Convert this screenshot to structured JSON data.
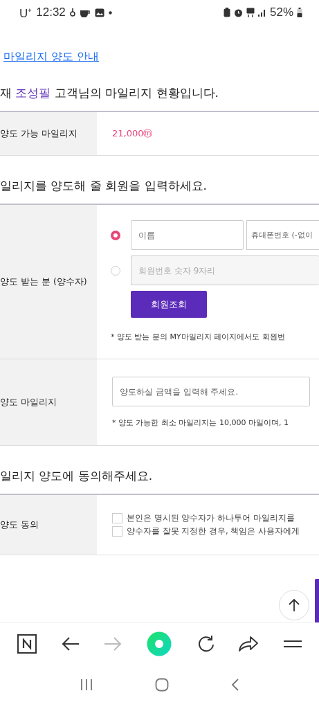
{
  "status_bar": {
    "carrier": "U⁺",
    "time": "12:32",
    "battery": "52%"
  },
  "guide_link": "마일리지 양도 안내",
  "summary": {
    "prefix": "재 ",
    "name": "조성필",
    "suffix": " 고객님의 마일리지 현황입니다."
  },
  "balance_row": {
    "label": "양도 가능 마일리지",
    "value": "21,000ⓜ"
  },
  "recipient_section": {
    "title": "일리지를 양도해 줄 회원을 입력하세요.",
    "label": "양도 받는 분 (양수자)",
    "options": [
      {
        "selected": true,
        "fields": [
          {
            "placeholder": "이름",
            "disabled": false
          },
          {
            "placeholder": "휴대폰번호 (-없이",
            "disabled": false
          }
        ]
      },
      {
        "selected": false,
        "fields": [
          {
            "placeholder": "회원번호 숫자 9자리",
            "disabled": true
          }
        ]
      }
    ],
    "button": "회원조회",
    "note": "* 양도 받는 분의 MY마일리지 페이지에서도 회원번"
  },
  "amount_row": {
    "label": "양도 마일리지",
    "placeholder": "양도하실 금액을 입력해 주세요.",
    "note": "* 양도 가능한 최소 마일리지는 10,000 마일이며, 1"
  },
  "agree_section": {
    "title": "일리지 양도에 동의해주세요.",
    "label": "양도 동의",
    "checks": [
      {
        "label": "본인은 명시된 양수자가 하나투어 마일리지를",
        "checked": false
      },
      {
        "label": "양수자를 잘못 지정한 경우, 책임은 사용자에게",
        "checked": false
      }
    ]
  }
}
